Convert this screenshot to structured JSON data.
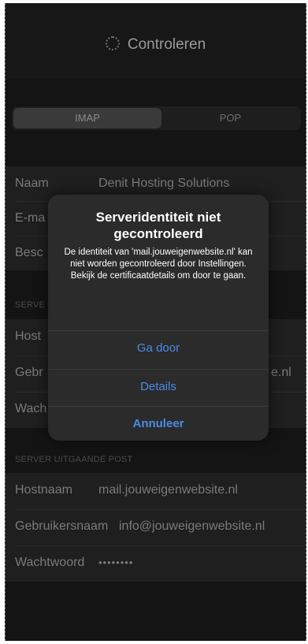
{
  "nav": {
    "title": "Controleren"
  },
  "tabs": [
    {
      "label": "IMAP"
    },
    {
      "label": "POP"
    }
  ],
  "account": {
    "name_label": "Naam",
    "name_value": "Denit Hosting Solutions",
    "email_label": "E-ma",
    "description_label": "Besc"
  },
  "incoming": {
    "section": "SERVE",
    "hostname_label": "Host",
    "username_label": "Gebr",
    "username_value_tail": "e.nl",
    "password_label": "Wach"
  },
  "outgoing": {
    "section": "SERVER UITGAANDE POST",
    "hostname_label": "Hostnaam",
    "hostname_value": "mail.jouweigenwebsite.nl",
    "username_label": "Gebruikersnaam",
    "username_value": "info@jouweigenwebsite.nl",
    "password_label": "Wachtwoord",
    "password_value": "••••••••"
  },
  "alert": {
    "title": "Serveridentiteit niet gecontroleerd",
    "message": "De identiteit van 'mail.jouweigenwebsite.nl' kan niet worden gecontroleerd door Instellingen. Bekijk de certificaatdetails om door te gaan.",
    "continue_label": "Ga door",
    "details_label": "Details",
    "cancel_label": "Annuleer"
  },
  "colors": {
    "accent": "#4a8be8",
    "alert_bg": "#2b2b2b"
  },
  "icons": {
    "spinner": "activity-spinner-icon"
  }
}
